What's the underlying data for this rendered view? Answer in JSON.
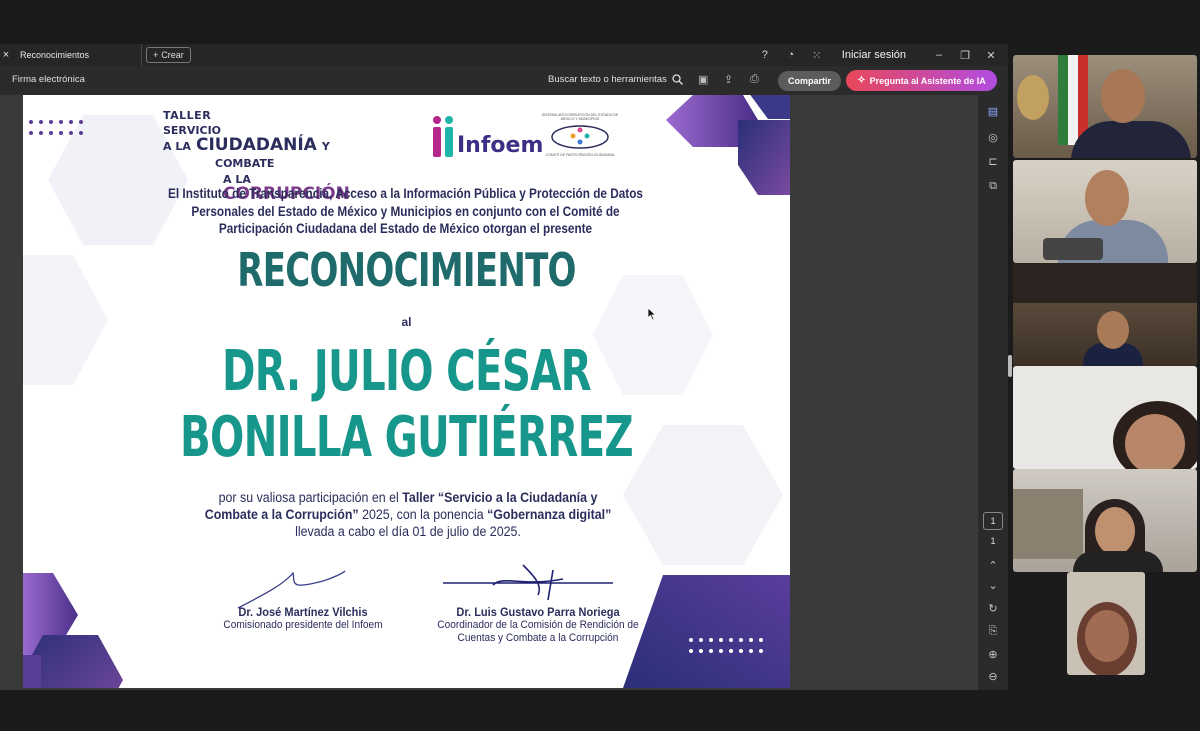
{
  "tabbar": {
    "close_glyph": "×",
    "tab_label": "Reconocimientos",
    "create_label": "Crear",
    "signin_label": "Iniciar sesión"
  },
  "toolbar": {
    "firma_label": "Firma electrónica",
    "search_label": "Buscar texto o herramientas",
    "share_label": "Compartir",
    "ai_label": "Pregunta al Asistente de IA"
  },
  "pagenav": {
    "current": "1",
    "total": "1"
  },
  "certificate": {
    "logo_taller_line1": "TALLER",
    "logo_taller_line2": "SERVICIO",
    "logo_taller_line3": "A LA",
    "logo_ciudadania": "CIUDADANÍA",
    "logo_y": "Y",
    "logo_combate": "COMBATE",
    "logo_ala2": "A LA",
    "logo_corrupcion": "CORRUPCIÓN",
    "logo_infoem": "Infoem",
    "logo_cpc_top": "SISTEMA ANTICORRUPCIÓN DEL ESTADO DE MÉXICO Y MUNICIPIOS",
    "logo_cpc_bottom": "COMITÉ DE PARTICIPACIÓN CIUDADANA",
    "intro": "El Instituto de Transparencia, Acceso a la Información Pública y Protección de Datos Personales del Estado de México y Municipios en conjunto con el Comité de Participación Ciudadana del Estado de México otorgan el presente",
    "title": "RECONOCIMIENTO",
    "al": "al",
    "name_line1": "DR. JULIO CÉSAR",
    "name_line2": "BONILLA GUTIÉRREZ",
    "body_1": "por su valiosa participación en el ",
    "body_taller": "Taller “Servicio a la Ciudadanía y Combate a la Corrupción”",
    "body_2": " 2025, con la ponencia ",
    "body_ponencia": "“Gobernanza digital”",
    "body_3": " llevada a cabo el día 01 de julio de 2025.",
    "sig1_name": "Dr. José Martínez Vilchis",
    "sig1_role": "Comisionado presidente del Infoem",
    "sig2_name": "Dr. Luis Gustavo Parra Noriega",
    "sig2_role_1": "Coordinador de la Comisión de Rendición de",
    "sig2_role_2": "Cuentas y Combate a la Corrupción"
  },
  "colors": {
    "teal": "#17968c",
    "dark_teal": "#1f6b6b",
    "navy": "#2b2e5c",
    "purple": "#6b3f98",
    "ai_gradient_start": "#e8475a",
    "ai_gradient_end": "#b14ce0"
  },
  "participants_count": 6
}
